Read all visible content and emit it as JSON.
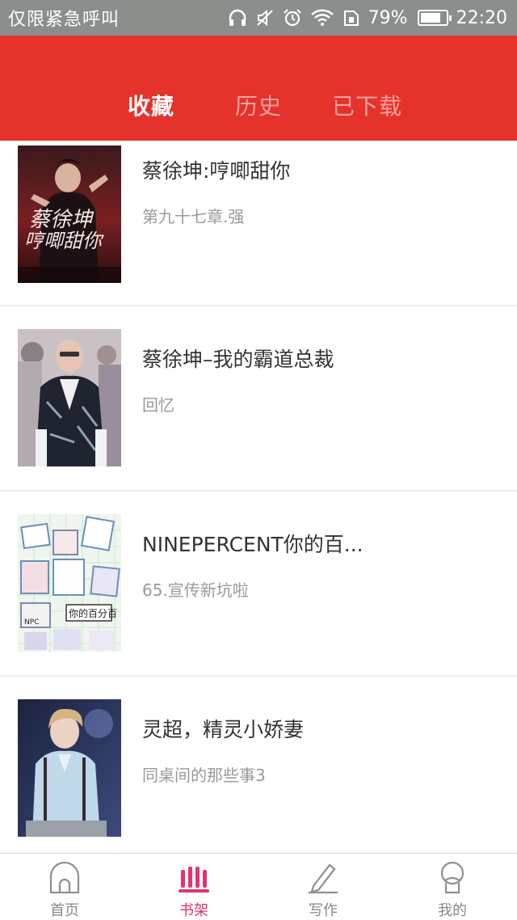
{
  "status_bar": {
    "left_text": "仅限紧急呼叫",
    "battery_percent": "79%",
    "battery_level": 0.79,
    "time": "22:20",
    "icons": [
      "headphones-icon",
      "mute-icon",
      "alarm-icon",
      "wifi-icon",
      "sim-icon",
      "battery-icon"
    ]
  },
  "header": {
    "background_color": "#e5322b",
    "tabs": [
      {
        "label": "收藏",
        "active": true
      },
      {
        "label": "历史",
        "active": false
      },
      {
        "label": "已下载",
        "active": false
      }
    ]
  },
  "books": [
    {
      "title": "蔡徐坤:哼唧甜你",
      "chapter": "第九十七章.强",
      "cover_text": "蔡徐坤哼唧甜你"
    },
    {
      "title": "蔡徐坤–我的霸道总裁",
      "chapter": "回忆"
    },
    {
      "title": "NINEPERCENT你的百...",
      "chapter": "65.宣传新坑啦",
      "cover_text": "你的百分百"
    },
    {
      "title": "灵超，精灵小娇妻",
      "chapter": "同桌间的那些事3"
    }
  ],
  "bottom_nav": {
    "accent_color": "#e5326b",
    "items": [
      {
        "label": "首页",
        "icon": "home-icon",
        "active": false
      },
      {
        "label": "书架",
        "icon": "bookshelf-icon",
        "active": true
      },
      {
        "label": "写作",
        "icon": "pencil-icon",
        "active": false
      },
      {
        "label": "我的",
        "icon": "profile-icon",
        "active": false
      }
    ]
  }
}
